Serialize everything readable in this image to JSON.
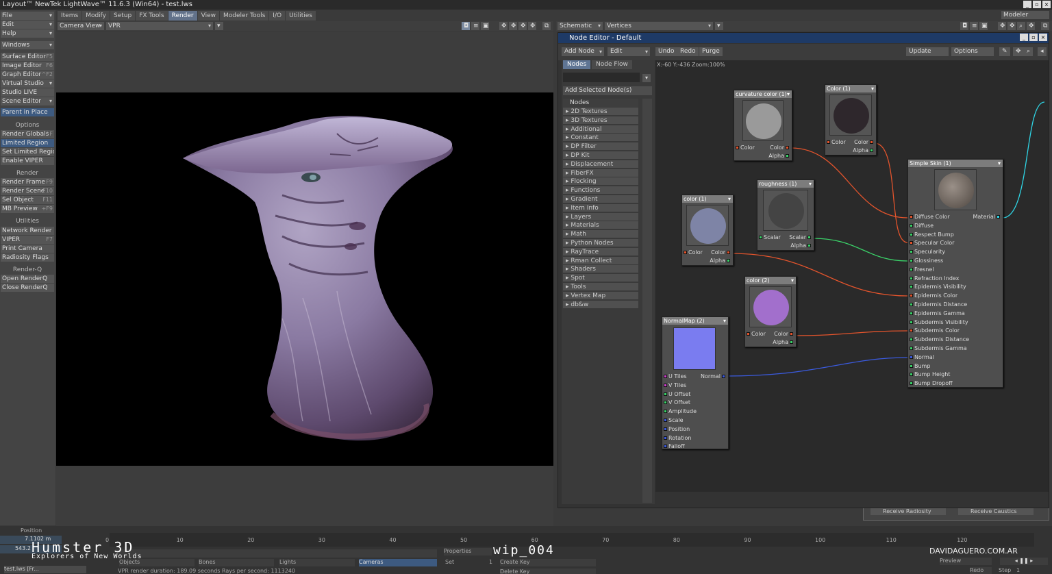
{
  "window": {
    "title": "Layout™ NewTek LightWave™ 11.6.3 (Win64) - test.lws"
  },
  "left_panel": {
    "menus": [
      "File",
      "Edit",
      "Help",
      "Windows"
    ],
    "editors": [
      {
        "label": "Surface Editor",
        "key": "F5"
      },
      {
        "label": "Image Editor",
        "key": "F6"
      },
      {
        "label": "Graph Editor",
        "key": "^F2"
      },
      {
        "label": "Virtual Studio",
        "key": ""
      },
      {
        "label": "Studio LIVE",
        "key": ""
      },
      {
        "label": "Scene Editor",
        "key": ""
      }
    ],
    "parent_in_place": "Parent in Place",
    "options_head": "Options",
    "options": [
      {
        "label": "Render Globals",
        "key": "^F"
      },
      {
        "label": "Limited Region",
        "key": ""
      },
      {
        "label": "Set Limited Region",
        "key": ""
      },
      {
        "label": "Enable VIPER",
        "key": ""
      }
    ],
    "render_head": "Render",
    "render": [
      {
        "label": "Render Frame",
        "key": "F9"
      },
      {
        "label": "Render Scene",
        "key": "F10"
      },
      {
        "label": "Sel Object",
        "key": "F11"
      },
      {
        "label": "MB Preview",
        "key": "+F9"
      }
    ],
    "utilities_head": "Utilities",
    "utilities": [
      {
        "label": "Network Render",
        "key": ""
      },
      {
        "label": "VIPER",
        "key": "F7"
      },
      {
        "label": "Print Camera",
        "key": ""
      },
      {
        "label": "Radiosity Flags",
        "key": ""
      }
    ],
    "renderq_head": "Render-Q",
    "renderq": [
      {
        "label": "Open RenderQ",
        "key": ""
      },
      {
        "label": "Close RenderQ",
        "key": ""
      }
    ]
  },
  "tabs": [
    "Items",
    "Modify",
    "Setup",
    "FX Tools",
    "Render",
    "View",
    "Modeler Tools",
    "I/O",
    "Utilities"
  ],
  "viewport": {
    "view": "Camera View",
    "mode": "VPR"
  },
  "right_bar": {
    "view": "Schematic",
    "mode": "Vertices",
    "modeler": "Modeler"
  },
  "node_editor": {
    "title": "Node Editor - Default",
    "toolbar": {
      "add_node": "Add Node",
      "edit": "Edit",
      "undo": "Undo",
      "redo": "Redo",
      "purge": "Purge",
      "update": "Update",
      "options": "Options"
    },
    "tabs": [
      "Nodes",
      "Node Flow"
    ],
    "add_selected": "Add Selected Node(s)",
    "list_header": "Nodes",
    "categories": [
      "2D Textures",
      "3D Textures",
      "Additional",
      "Constant",
      "DP Filter",
      "DP Kit",
      "Displacement",
      "FiberFX",
      "Flocking",
      "Functions",
      "Gradient",
      "Item Info",
      "Layers",
      "Materials",
      "Math",
      "Python Nodes",
      "RayTrace",
      "Rman Collect",
      "Shaders",
      "Spot",
      "Tools",
      "Vertex Map",
      "db&w"
    ],
    "coords": "X:-60 Y:-436 Zoom:100%",
    "nodes": {
      "curvature": {
        "title": "curvature color (1)",
        "in": "Color",
        "out1": "Color",
        "out2": "Alpha"
      },
      "color1": {
        "title": "Color (1)",
        "in": "Color",
        "out1": "Color",
        "out2": "Alpha"
      },
      "roughness": {
        "title": "roughness (1)",
        "in": "Scalar",
        "out1": "Scalar",
        "out2": "Alpha"
      },
      "color_1": {
        "title": "color (1)",
        "in": "Color",
        "out1": "Color",
        "out2": "Alpha"
      },
      "color2": {
        "title": "color (2)",
        "in": "Color",
        "out1": "Color",
        "out2": "Alpha"
      },
      "normalmap": {
        "title": "NormalMap (2)",
        "out": "Normal",
        "inputs": [
          "U Tiles",
          "V Tiles",
          "U Offset",
          "V Offset",
          "Amplitude",
          "Scale",
          "Position",
          "Rotation",
          "Falloff"
        ]
      },
      "skin": {
        "title": "Simple Skin (1)",
        "out": "Material",
        "inputs": [
          "Diffuse Color",
          "Diffuse",
          "Respect Bump",
          "Specular Color",
          "Specularity",
          "Glossiness",
          "Fresnel",
          "Refraction Index",
          "Epidermis Visibility",
          "Epidermis Color",
          "Epidermis Distance",
          "Epidermis Gamma",
          "Subdermis Visibility",
          "Subdermis Color",
          "Subdermis Distance",
          "Subdermis Gamma",
          "Normal",
          "Bump",
          "Bump Height",
          "Bump Dropoff"
        ]
      }
    },
    "bottom_behind": {
      "a": "Receive Radiosity",
      "b": "Receive Caustics"
    }
  },
  "timeline": {
    "position_label": "Position",
    "x_value": "7.1102 m",
    "y_value": "543.2",
    "ticks": [
      "0",
      "10",
      "20",
      "30",
      "40",
      "50",
      "60",
      "70",
      "80",
      "90",
      "100",
      "110",
      "120"
    ],
    "objects": "Objects",
    "bones": "Bones",
    "lights": "Lights",
    "cameras": "Cameras",
    "properties": "Properties",
    "set": "Set",
    "create_key": "Create Key",
    "delete_key": "Delete Key",
    "status": "VPR render duration: 189.09 seconds  Rays per second: 1113240",
    "preview": "Preview",
    "redo": "Redo",
    "step": "Step",
    "step_value": "1",
    "set_value": "1",
    "task": "test.lws [Fr..."
  },
  "overlay": {
    "brand": "Humster 3D",
    "tagline": "Explorers of New Worlds",
    "wip": "wip_004",
    "site": "DAVIDAGUERO.COM.AR"
  },
  "colors": {
    "accent": "#3d5a80",
    "title_blue": "#1e3a66",
    "wire_red": "#e4542c",
    "wire_green": "#3bd46a",
    "wire_blue": "#3b5be0",
    "wire_cyan": "#2fd6e6"
  }
}
